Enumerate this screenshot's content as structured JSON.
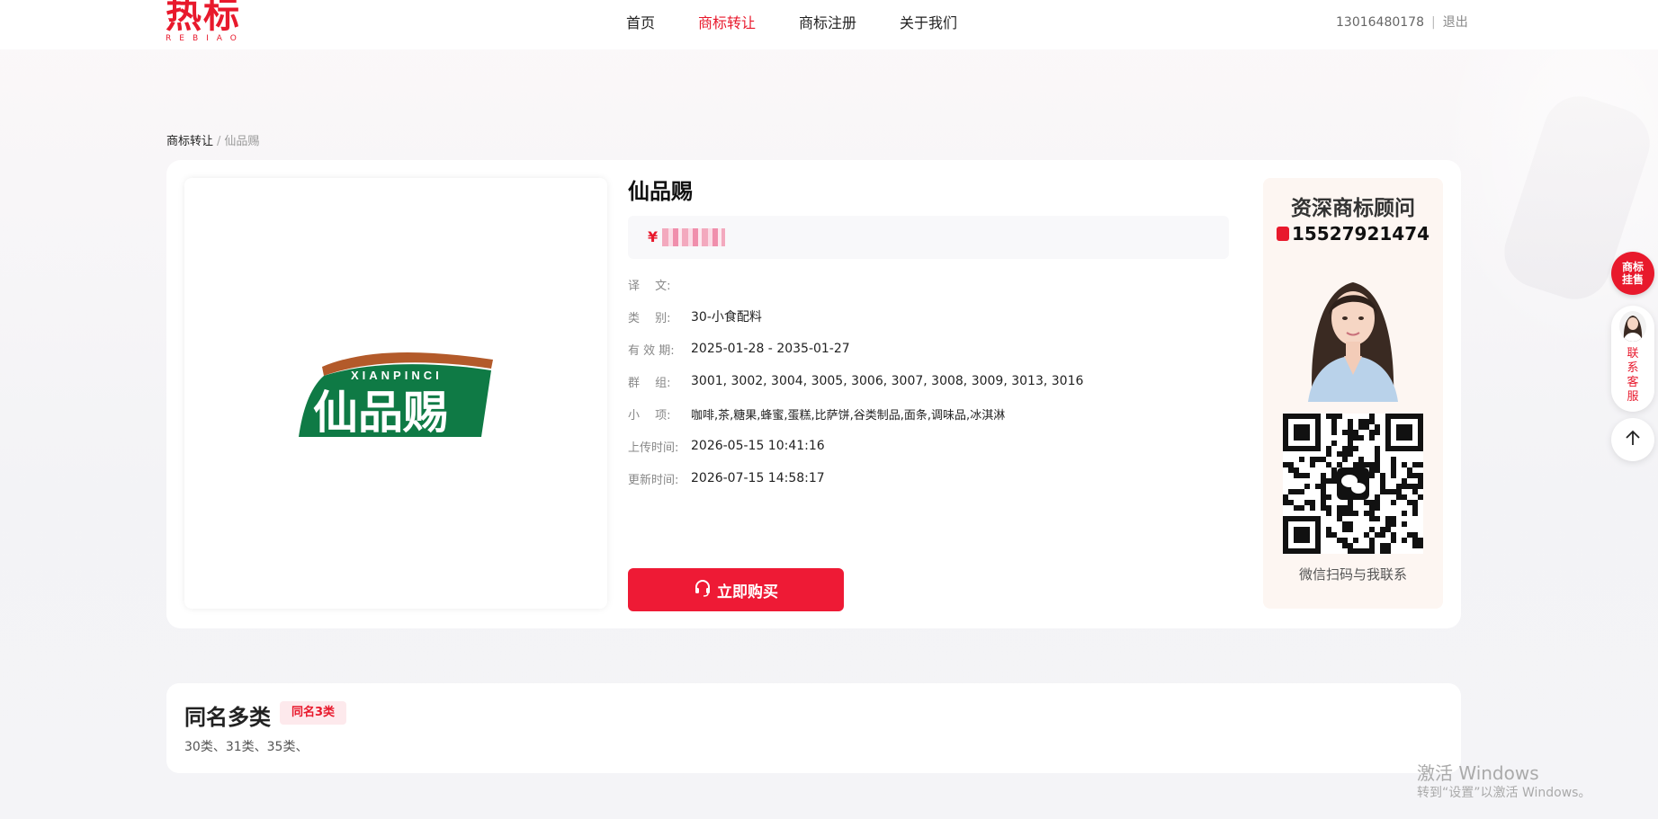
{
  "header": {
    "logo_text": "热标",
    "logo_sub": "REBIAO",
    "nav": [
      {
        "label": "首页",
        "active": false
      },
      {
        "label": "商标转让",
        "active": true
      },
      {
        "label": "商标注册",
        "active": false
      },
      {
        "label": "关于我们",
        "active": false
      }
    ],
    "user_phone": "13016480178",
    "separator": "|",
    "logout": "退出"
  },
  "breadcrumb": {
    "parent": "商标转让",
    "separator": "/",
    "current": "仙品赐"
  },
  "trademark": {
    "image_name": "仙品赐",
    "image_pinyin": "XIANPINCI",
    "title": "仙品赐",
    "price_symbol": "¥",
    "fields": [
      {
        "label": "译　 文:",
        "value": ""
      },
      {
        "label": "类　 别:",
        "value": "30-小食配料"
      },
      {
        "label": "有 效 期:",
        "value": "2025-01-28 - 2035-01-27"
      },
      {
        "label": "群　 组:",
        "value": "3001, 3002, 3004, 3005, 3006, 3007, 3008, 3009, 3013, 3016"
      },
      {
        "label": "小　 项:",
        "value": "咖啡,茶,糖果,蜂蜜,蛋糕,比萨饼,谷类制品,面条,调味品,冰淇淋"
      },
      {
        "label": "上传时间:",
        "value": "2026-05-15 10:41:16"
      },
      {
        "label": "更新时间:",
        "value": "2026-07-15 14:58:17"
      }
    ],
    "buy_label": "立即购买"
  },
  "advisor": {
    "title": "资深商标顾问",
    "phone": "15527921474",
    "caption": "微信扫码与我联系"
  },
  "same_name": {
    "title": "同名多类",
    "badge": "同名3类",
    "list": "30类、31类、35类、"
  },
  "floating": {
    "listing_label_1": "商标",
    "listing_label_2": "挂售",
    "cs_label_1": "联",
    "cs_label_2": "系",
    "cs_label_3": "客",
    "cs_label_4": "服"
  },
  "watermark": {
    "line1": "激活 Windows",
    "line2": "转到“设置”以激活 Windows。"
  },
  "colors": {
    "accent": "#e8192c",
    "logo_green": "#0f7a45",
    "logo_brown": "#b35a2a"
  },
  "icons": [
    "headset-icon",
    "phone-icon",
    "wechat-icon",
    "arrow-up-icon"
  ]
}
